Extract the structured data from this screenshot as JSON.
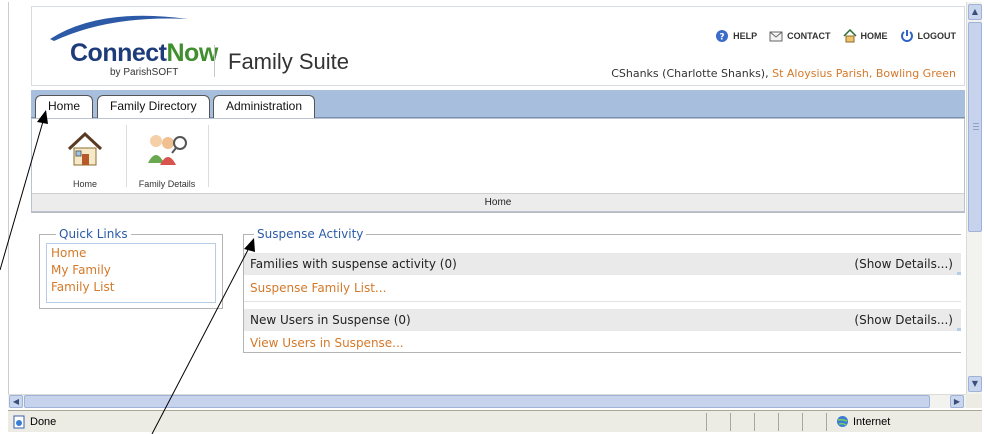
{
  "header": {
    "logo_connect": "Connect",
    "logo_now": "Now",
    "logo_by": "by ParishSOFT",
    "suite_title": "Family Suite",
    "links": [
      {
        "label": "HELP",
        "icon": "help-icon"
      },
      {
        "label": "CONTACT",
        "icon": "contact-icon"
      },
      {
        "label": "HOME",
        "icon": "home-icon"
      },
      {
        "label": "LOGOUT",
        "icon": "logout-icon"
      }
    ],
    "user": "CShanks (Charlotte Shanks),",
    "parish": "St Aloysius Parish, Bowling Green"
  },
  "tabs": [
    "Home",
    "Family Directory",
    "Administration"
  ],
  "tray": {
    "items": [
      {
        "label": "Home",
        "icon": "house-icon"
      },
      {
        "label": "Family Details",
        "icon": "family-search-icon"
      }
    ],
    "footer": "Home"
  },
  "quick_links": {
    "legend": "Quick Links",
    "items": [
      "Home",
      "My Family",
      "Family List"
    ]
  },
  "suspense": {
    "legend": "Suspense Activity",
    "families_row": "Families with suspense activity (0)",
    "families_show": "(Show Details...)",
    "families_link": "Suspense Family List...",
    "users_row": "New Users in Suspense (0)",
    "users_show": "(Show Details...)",
    "users_link": "View Users in Suspense..."
  },
  "statusbar": {
    "status": "Done",
    "zone": "Internet"
  },
  "colors": {
    "accent_link": "#d4792a",
    "legend_blue": "#2b5ba8",
    "tabbar": "#a7bfdd",
    "brand_blue": "#1f3c7a",
    "brand_green": "#3f8f2e"
  }
}
